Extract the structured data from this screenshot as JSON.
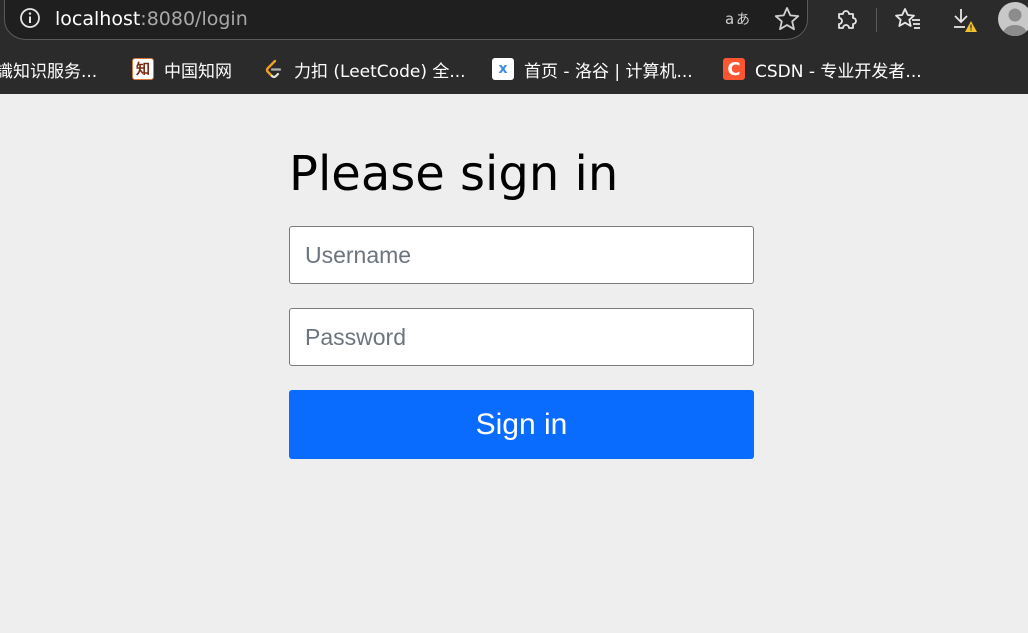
{
  "browser": {
    "url_host": "localhost",
    "url_rest": ":8080/login",
    "icons": [
      "info-icon",
      "translate-icon",
      "star-icon",
      "extensions-icon",
      "favorites-icon",
      "downloads-icon",
      "avatar"
    ],
    "bookmarks": [
      {
        "label": "識知识服务...",
        "icon": "bookmark-icon"
      },
      {
        "label": "中国知网",
        "icon": "cnki-icon",
        "glyph": "知"
      },
      {
        "label": "力扣 (LeetCode) 全...",
        "icon": "leetcode-icon"
      },
      {
        "label": "首页 - 洛谷 | 计算机...",
        "icon": "luogu-icon",
        "glyph": "x"
      },
      {
        "label": "CSDN - 专业开发者...",
        "icon": "csdn-icon",
        "glyph": "C"
      }
    ]
  },
  "login": {
    "heading": "Please sign in",
    "username_placeholder": "Username",
    "password_placeholder": "Password",
    "submit_label": "Sign in"
  },
  "colors": {
    "page_bg": "#eeeeee",
    "button_bg": "#0a6cff",
    "chrome_bg": "#2b2b2b"
  }
}
